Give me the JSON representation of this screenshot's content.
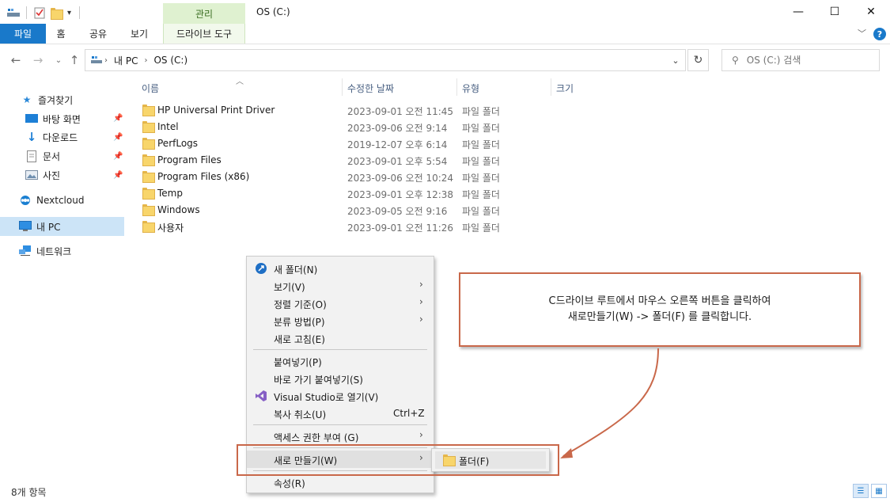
{
  "window": {
    "title": "OS (C:)",
    "manage_tab": "관리",
    "minimize": "—",
    "maximize": "☐",
    "close": "✕"
  },
  "ribbon": {
    "tabs": [
      "파일",
      "홈",
      "공유",
      "보기",
      "드라이브 도구"
    ],
    "help": "?"
  },
  "address": {
    "segments": [
      "내 PC",
      "OS (C:)"
    ],
    "search_placeholder": "OS (C:) 검색"
  },
  "sidebar": {
    "quick_access": "즐겨찾기",
    "items": [
      {
        "label": "바탕 화면"
      },
      {
        "label": "다운로드"
      },
      {
        "label": "문서"
      },
      {
        "label": "사진"
      }
    ],
    "nextcloud": "Nextcloud",
    "this_pc": "내 PC",
    "network": "네트워크"
  },
  "columns": {
    "name": "이름",
    "date": "수정한 날짜",
    "type": "유형",
    "size": "크기"
  },
  "files": [
    {
      "name": "HP Universal Print Driver",
      "date": "2023-09-01 오전 11:45",
      "type": "파일 폴더"
    },
    {
      "name": "Intel",
      "date": "2023-09-06 오전 9:14",
      "type": "파일 폴더"
    },
    {
      "name": "PerfLogs",
      "date": "2019-12-07 오후 6:14",
      "type": "파일 폴더"
    },
    {
      "name": "Program Files",
      "date": "2023-09-01 오후 5:54",
      "type": "파일 폴더"
    },
    {
      "name": "Program Files (x86)",
      "date": "2023-09-06 오전 10:24",
      "type": "파일 폴더"
    },
    {
      "name": "Temp",
      "date": "2023-09-01 오후 12:38",
      "type": "파일 폴더"
    },
    {
      "name": "Windows",
      "date": "2023-09-05 오전 9:16",
      "type": "파일 폴더"
    },
    {
      "name": "사용자",
      "date": "2023-09-01 오전 11:26",
      "type": "파일 폴더"
    }
  ],
  "context_menu": {
    "new_folder": "새 폴더(N)",
    "view": "보기(V)",
    "sort": "정렬 기준(O)",
    "group": "분류 방법(P)",
    "refresh": "새로 고침(E)",
    "paste": "붙여넣기(P)",
    "paste_shortcut": "바로 가기 붙여넣기(S)",
    "open_vs": "Visual Studio로 열기(V)",
    "undo_copy": "복사 취소(U)",
    "undo_shortcut": "Ctrl+Z",
    "access": "액세스 권한 부여 (G)",
    "new": "새로 만들기(W)",
    "properties": "속성(R)"
  },
  "submenu": {
    "folder": "폴더(F)"
  },
  "callout": {
    "line1": "C드라이브 루트에서 마우스 오른쪽 버튼을 클릭하여",
    "line2": "새로만들기(W) -> 폴더(F) 를 클릭합니다."
  },
  "status": {
    "count": "8개 항목"
  },
  "colors": {
    "accent": "#1979ca",
    "annotation": "#c9684a"
  }
}
